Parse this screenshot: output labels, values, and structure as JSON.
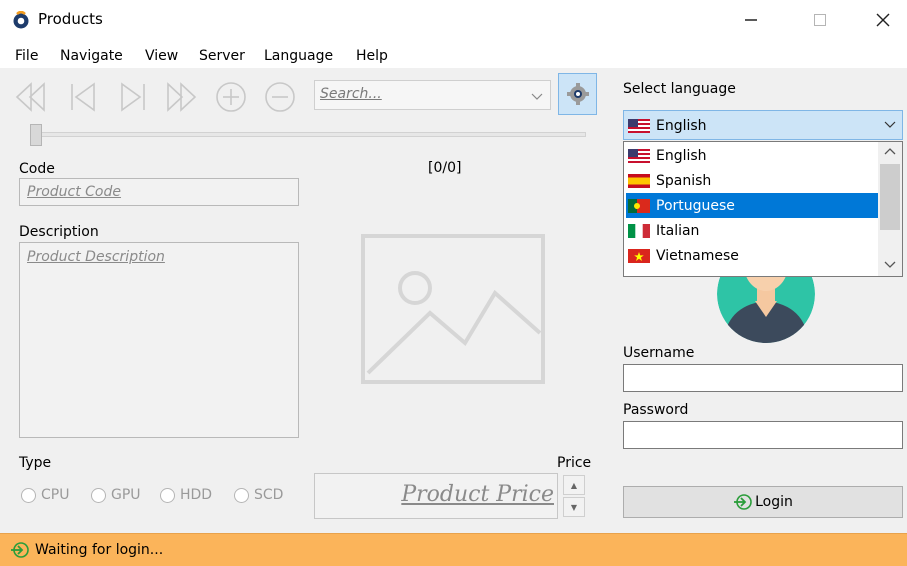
{
  "window": {
    "title": "Products"
  },
  "menu": [
    "File",
    "Navigate",
    "View",
    "Server",
    "Language",
    "Help"
  ],
  "toolbar": {
    "search_placeholder": "Search..."
  },
  "record_counter": "[0/0]",
  "form": {
    "code_label": "Code",
    "code_placeholder": "Product Code",
    "description_label": "Description",
    "description_placeholder": "Product Description",
    "type_label": "Type",
    "types": [
      "CPU",
      "GPU",
      "HDD",
      "SCD"
    ],
    "price_label": "Price",
    "price_placeholder": "Product Price"
  },
  "language": {
    "label": "Select language",
    "selected": "English",
    "options": [
      "English",
      "Spanish",
      "Portuguese",
      "Italian",
      "Vietnamese"
    ],
    "highlighted": "Portuguese"
  },
  "login": {
    "username_label": "Username",
    "username_value": "",
    "password_label": "Password",
    "password_value": "",
    "button_label": "Login"
  },
  "status": {
    "text": "Waiting for login..."
  },
  "colors": {
    "accent": "#0078d7",
    "status_bar": "#fbb45a",
    "select_bg": "#cce4f7"
  }
}
